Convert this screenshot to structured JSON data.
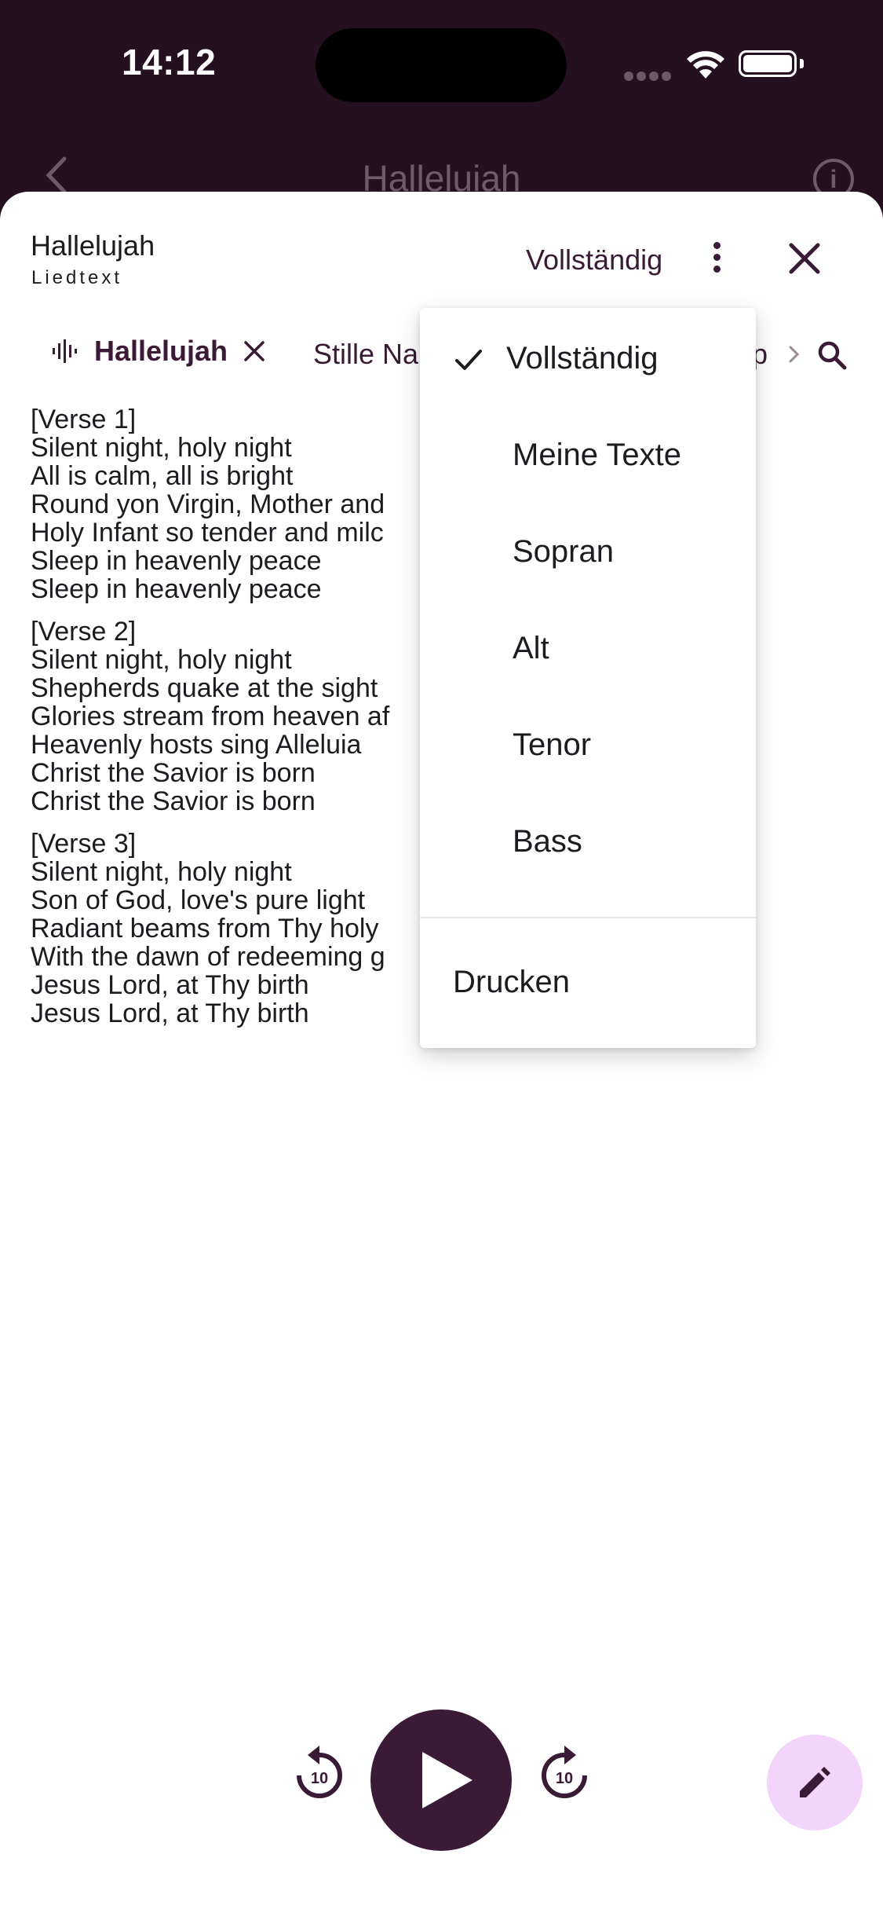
{
  "status_bar": {
    "time": "14:12"
  },
  "background_screen": {
    "title": "Halleluiah"
  },
  "sheet": {
    "title": "Hallelujah",
    "subtitle": "Liedtext",
    "version_label": "Vollständig"
  },
  "tabs": {
    "active": "Hallelujah",
    "second": "Stille Na",
    "third": "p"
  },
  "lyrics": [
    {
      "lines": [
        "[Verse 1]",
        "Silent night, holy night",
        "All is calm, all is bright",
        "Round yon Virgin, Mother and",
        "Holy Infant so tender and milc",
        "Sleep in heavenly peace",
        "Sleep in heavenly peace"
      ]
    },
    {
      "lines": [
        "[Verse 2]",
        "Silent night, holy night",
        "Shepherds quake at the sight",
        "Glories stream from heaven af",
        "Heavenly hosts sing Alleluia",
        "Christ the Savior is born",
        "Christ the Savior is born"
      ]
    },
    {
      "lines": [
        "[Verse 3]",
        "Silent night, holy night",
        "Son of God, love's pure light",
        "Radiant beams from Thy holy",
        "With the dawn of redeeming g",
        "Jesus Lord, at Thy birth",
        "Jesus Lord, at Thy birth"
      ]
    }
  ],
  "menu": {
    "items": [
      "Vollständig",
      "Meine Texte",
      "Sopran",
      "Alt",
      "Tenor",
      "Bass"
    ],
    "selected": "Vollständig",
    "print": "Drucken"
  },
  "player": {
    "rewind_seconds": "10",
    "forward_seconds": "10"
  },
  "colors": {
    "primary": "#3a1a35",
    "status_bar_bg": "#24101f",
    "fab_bg": "#f3d4fb"
  }
}
